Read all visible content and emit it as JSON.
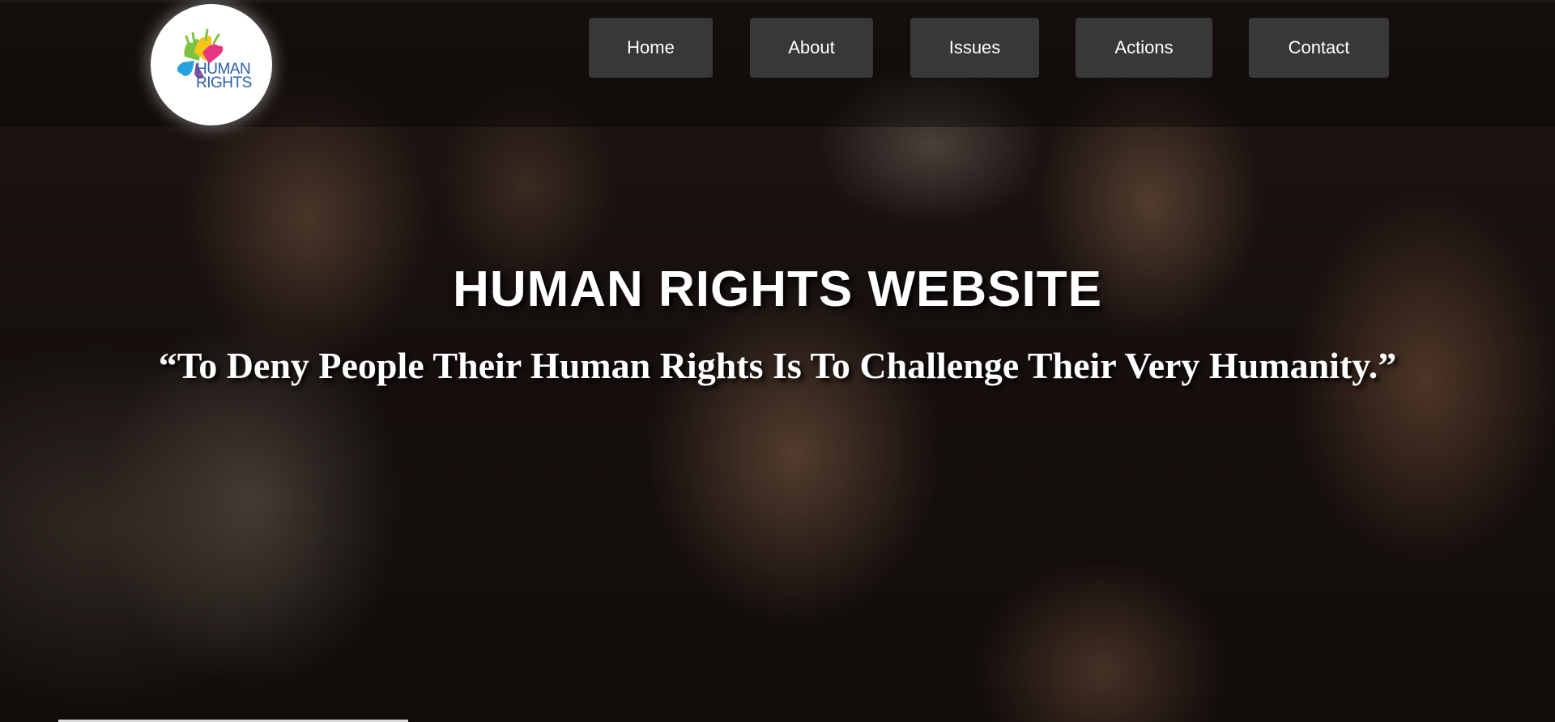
{
  "logo": {
    "text_line1": "HUMAN",
    "text_line2": "RIGHTS",
    "icon": "colorful-hands-icon",
    "colors": [
      "#7cc242",
      "#f5c518",
      "#e5367f",
      "#22a3d9",
      "#8a4fa3"
    ]
  },
  "nav": {
    "items": [
      {
        "label": "Home"
      },
      {
        "label": "About"
      },
      {
        "label": "Issues"
      },
      {
        "label": "Actions"
      },
      {
        "label": "Contact"
      }
    ],
    "button_color": "#383838"
  },
  "hero": {
    "title": "HUMAN RIGHTS WEBSITE",
    "quote": "“To Deny People Their Human Rights Is To Challenge Their Very Humanity.”"
  }
}
